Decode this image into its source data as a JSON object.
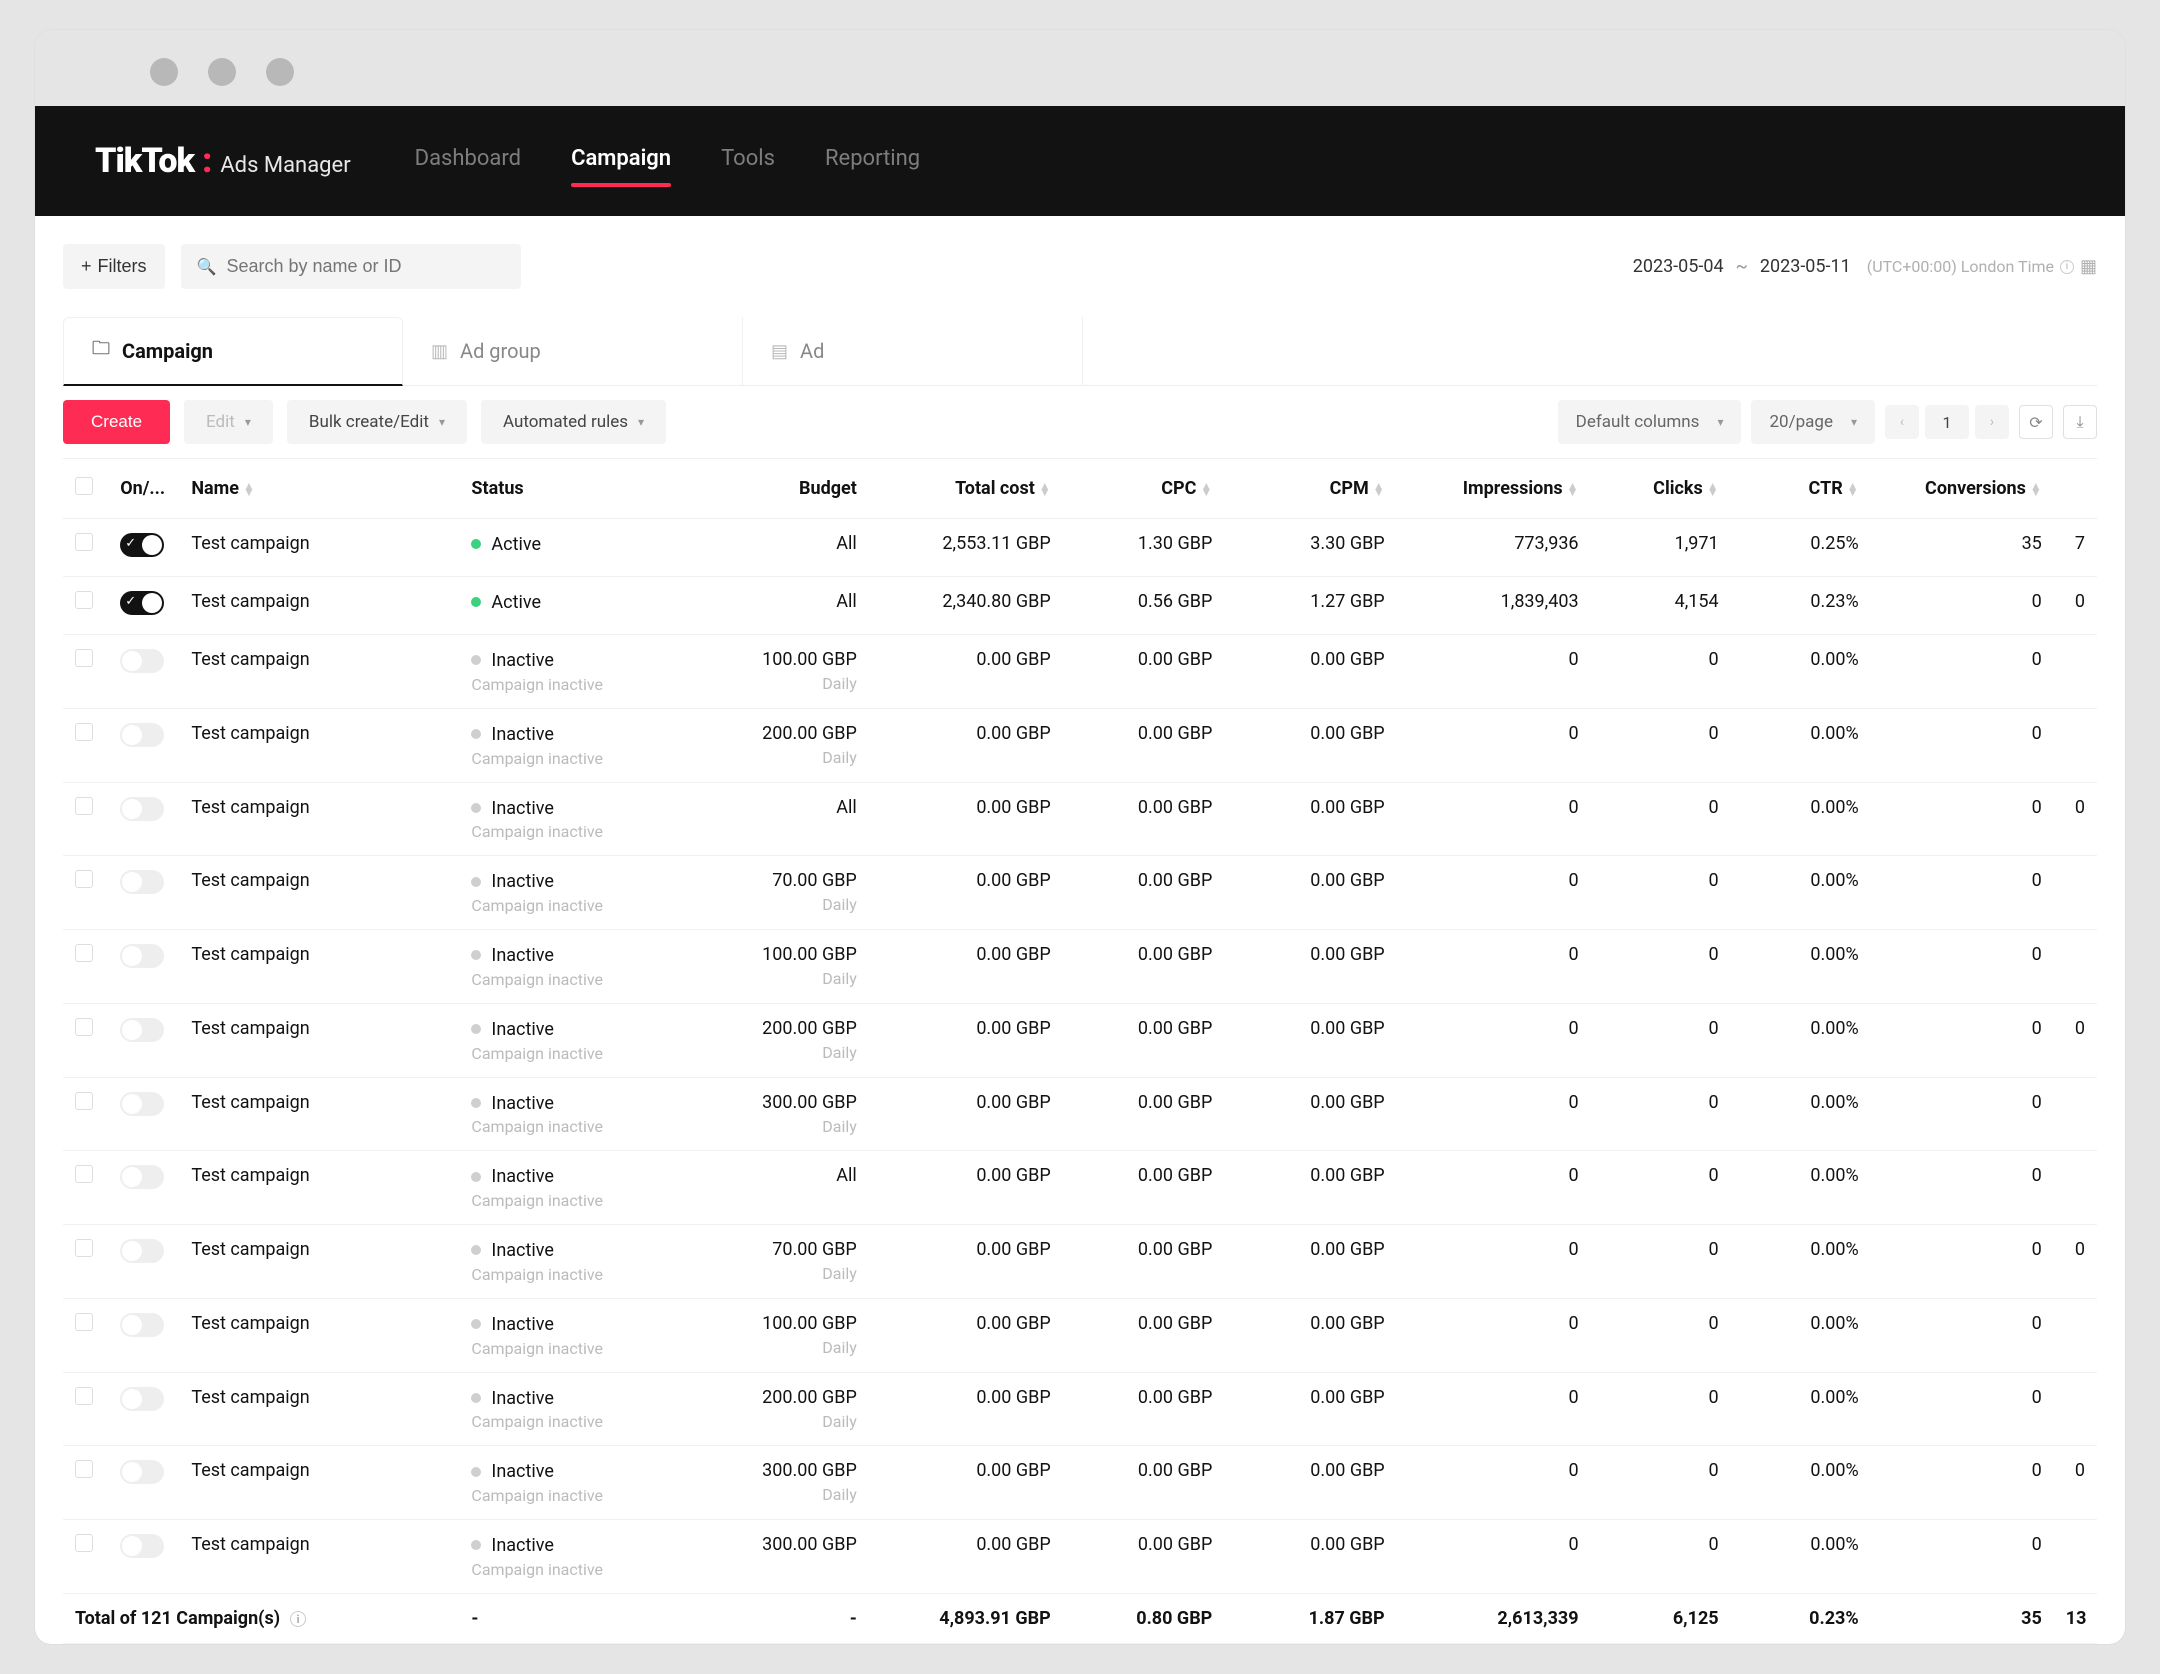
{
  "logo": {
    "brand": "TikTok",
    "colon": ":",
    "subtitle": "Ads Manager"
  },
  "nav": {
    "dashboard": "Dashboard",
    "campaign": "Campaign",
    "tools": "Tools",
    "reporting": "Reporting"
  },
  "filters": {
    "button": "Filters",
    "search_placeholder": "Search by name or ID"
  },
  "daterange": {
    "from": "2023-05-04",
    "to": "2023-05-11",
    "tz": "(UTC+00:00) London Time"
  },
  "tabs": {
    "campaign": "Campaign",
    "adgroup": "Ad group",
    "ad": "Ad"
  },
  "toolbar": {
    "create": "Create",
    "edit": "Edit",
    "bulk": "Bulk create/Edit",
    "rules": "Automated rules",
    "columns": "Default columns",
    "perpage": "20/page",
    "page": "1"
  },
  "columns": {
    "onoff": "On/...",
    "name": "Name",
    "status": "Status",
    "budget": "Budget",
    "totalcost": "Total cost",
    "cpc": "CPC",
    "cpm": "CPM",
    "impressions": "Impressions",
    "clicks": "Clicks",
    "ctr": "CTR",
    "conversions": "Conversions"
  },
  "status_labels": {
    "active": "Active",
    "inactive": "Inactive",
    "inactive_sub": "Campaign inactive"
  },
  "budget_sub": {
    "daily": "Daily"
  },
  "rows": [
    {
      "on": true,
      "name": "Test campaign",
      "status": "active",
      "budget": "All",
      "budget_sub": "",
      "cost": "2,553.11 GBP",
      "cpc": "1.30 GBP",
      "cpm": "3.30 GBP",
      "imp": "773,936",
      "clicks": "1,971",
      "ctr": "0.25%",
      "conv": "35",
      "over": "7"
    },
    {
      "on": true,
      "name": "Test campaign",
      "status": "active",
      "budget": "All",
      "budget_sub": "",
      "cost": "2,340.80 GBP",
      "cpc": "0.56 GBP",
      "cpm": "1.27 GBP",
      "imp": "1,839,403",
      "clicks": "4,154",
      "ctr": "0.23%",
      "conv": "0",
      "over": "0"
    },
    {
      "on": false,
      "name": "Test campaign",
      "status": "inactive",
      "budget": "100.00 GBP",
      "budget_sub": "Daily",
      "cost": "0.00 GBP",
      "cpc": "0.00 GBP",
      "cpm": "0.00 GBP",
      "imp": "0",
      "clicks": "0",
      "ctr": "0.00%",
      "conv": "0",
      "over": ""
    },
    {
      "on": false,
      "name": "Test campaign",
      "status": "inactive",
      "budget": "200.00 GBP",
      "budget_sub": "Daily",
      "cost": "0.00 GBP",
      "cpc": "0.00 GBP",
      "cpm": "0.00 GBP",
      "imp": "0",
      "clicks": "0",
      "ctr": "0.00%",
      "conv": "0",
      "over": ""
    },
    {
      "on": false,
      "name": "Test campaign",
      "status": "inactive",
      "budget": "All",
      "budget_sub": "",
      "cost": "0.00 GBP",
      "cpc": "0.00 GBP",
      "cpm": "0.00 GBP",
      "imp": "0",
      "clicks": "0",
      "ctr": "0.00%",
      "conv": "0",
      "over": "0"
    },
    {
      "on": false,
      "name": "Test campaign",
      "status": "inactive",
      "budget": "70.00 GBP",
      "budget_sub": "Daily",
      "cost": "0.00 GBP",
      "cpc": "0.00 GBP",
      "cpm": "0.00 GBP",
      "imp": "0",
      "clicks": "0",
      "ctr": "0.00%",
      "conv": "0",
      "over": ""
    },
    {
      "on": false,
      "name": "Test campaign",
      "status": "inactive",
      "budget": "100.00 GBP",
      "budget_sub": "Daily",
      "cost": "0.00 GBP",
      "cpc": "0.00 GBP",
      "cpm": "0.00 GBP",
      "imp": "0",
      "clicks": "0",
      "ctr": "0.00%",
      "conv": "0",
      "over": ""
    },
    {
      "on": false,
      "name": "Test campaign",
      "status": "inactive",
      "budget": "200.00 GBP",
      "budget_sub": "Daily",
      "cost": "0.00 GBP",
      "cpc": "0.00 GBP",
      "cpm": "0.00 GBP",
      "imp": "0",
      "clicks": "0",
      "ctr": "0.00%",
      "conv": "0",
      "over": "0"
    },
    {
      "on": false,
      "name": "Test campaign",
      "status": "inactive",
      "budget": "300.00 GBP",
      "budget_sub": "Daily",
      "cost": "0.00 GBP",
      "cpc": "0.00 GBP",
      "cpm": "0.00 GBP",
      "imp": "0",
      "clicks": "0",
      "ctr": "0.00%",
      "conv": "0",
      "over": ""
    },
    {
      "on": false,
      "name": "Test campaign",
      "status": "inactive",
      "budget": "All",
      "budget_sub": "",
      "cost": "0.00 GBP",
      "cpc": "0.00 GBP",
      "cpm": "0.00 GBP",
      "imp": "0",
      "clicks": "0",
      "ctr": "0.00%",
      "conv": "0",
      "over": ""
    },
    {
      "on": false,
      "name": "Test campaign",
      "status": "inactive",
      "budget": "70.00 GBP",
      "budget_sub": "Daily",
      "cost": "0.00 GBP",
      "cpc": "0.00 GBP",
      "cpm": "0.00 GBP",
      "imp": "0",
      "clicks": "0",
      "ctr": "0.00%",
      "conv": "0",
      "over": "0"
    },
    {
      "on": false,
      "name": "Test campaign",
      "status": "inactive",
      "budget": "100.00 GBP",
      "budget_sub": "Daily",
      "cost": "0.00 GBP",
      "cpc": "0.00 GBP",
      "cpm": "0.00 GBP",
      "imp": "0",
      "clicks": "0",
      "ctr": "0.00%",
      "conv": "0",
      "over": ""
    },
    {
      "on": false,
      "name": "Test campaign",
      "status": "inactive",
      "budget": "200.00 GBP",
      "budget_sub": "Daily",
      "cost": "0.00 GBP",
      "cpc": "0.00 GBP",
      "cpm": "0.00 GBP",
      "imp": "0",
      "clicks": "0",
      "ctr": "0.00%",
      "conv": "0",
      "over": ""
    },
    {
      "on": false,
      "name": "Test campaign",
      "status": "inactive",
      "budget": "300.00 GBP",
      "budget_sub": "Daily",
      "cost": "0.00 GBP",
      "cpc": "0.00 GBP",
      "cpm": "0.00 GBP",
      "imp": "0",
      "clicks": "0",
      "ctr": "0.00%",
      "conv": "0",
      "over": "0"
    },
    {
      "on": false,
      "name": "Test campaign",
      "status": "inactive",
      "budget": "300.00 GBP",
      "budget_sub": "",
      "cost": "0.00 GBP",
      "cpc": "0.00 GBP",
      "cpm": "0.00 GBP",
      "imp": "0",
      "clicks": "0",
      "ctr": "0.00%",
      "conv": "0",
      "over": ""
    }
  ],
  "totals": {
    "label": "Total of 121 Campaign(s)",
    "status": "-",
    "budget": "-",
    "cost": "4,893.91 GBP",
    "cpc": "0.80 GBP",
    "cpm": "1.87 GBP",
    "imp": "2,613,339",
    "clicks": "6,125",
    "ctr": "0.23%",
    "conv": "35",
    "over": "13"
  }
}
